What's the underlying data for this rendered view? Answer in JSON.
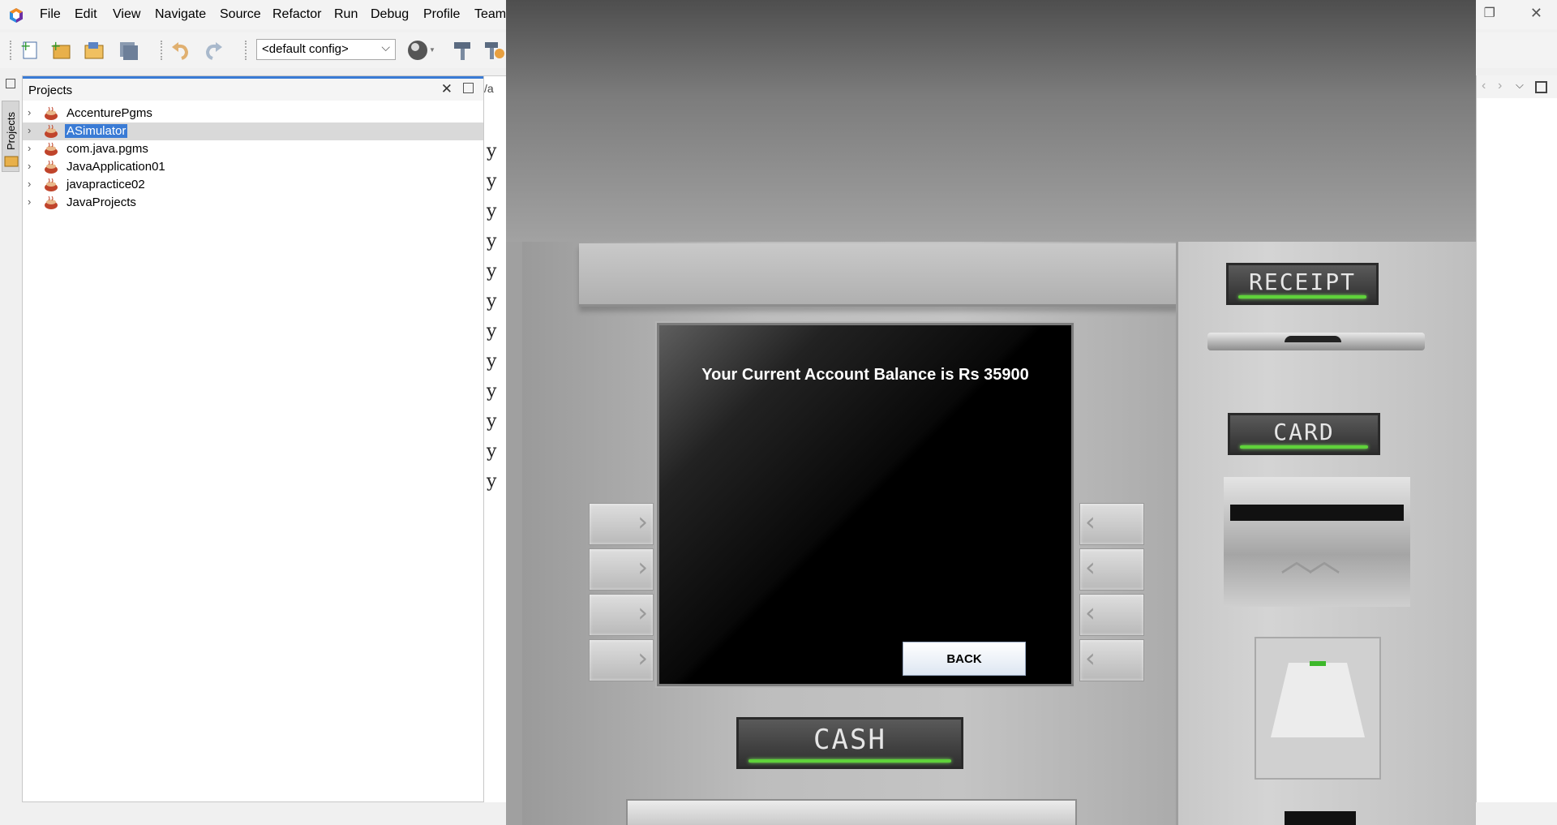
{
  "ide": {
    "menu": [
      "File",
      "Edit",
      "View",
      "Navigate",
      "Source",
      "Refactor",
      "Run",
      "Debug",
      "Profile",
      "Team"
    ],
    "toolbar": {
      "config_value": "<default config>",
      "buttons": [
        "new-file-icon",
        "new-project-icon",
        "open-project-icon",
        "save-all-icon",
        "undo-icon",
        "redo-icon",
        "run-globe-icon",
        "build-hammer-icon",
        "clean-build-icon"
      ]
    },
    "side_tab_label": "Projects",
    "projects_panel": {
      "title": "Projects",
      "items": [
        {
          "label": "AccenturePgms",
          "selected": false
        },
        {
          "label": "ASimulator",
          "selected": true
        },
        {
          "label": "com.java.pgms",
          "selected": false
        },
        {
          "label": "JavaApplication01",
          "selected": false
        },
        {
          "label": "javapractice02",
          "selected": false
        },
        {
          "label": "JavaProjects",
          "selected": false
        }
      ]
    },
    "editor_tab_fragment": "/a",
    "code_fragments": [
      "y",
      "y",
      "y",
      "y",
      "y",
      "y",
      "y",
      "y",
      "y",
      "y",
      "y",
      "y"
    ]
  },
  "atm": {
    "screen_message": "Your Current Account Balance is Rs 35900",
    "back_button": "BACK",
    "labels": {
      "receipt": "RECEIPT",
      "card": "CARD",
      "cash": "CASH"
    },
    "colors": {
      "indicator_green": "#5fd23a",
      "screen_black": "#000000",
      "label_dark": "#3a3a3a"
    },
    "left_keys": [
      "›",
      "›",
      "›",
      "›"
    ],
    "right_keys": [
      "‹",
      "‹",
      "‹",
      "‹"
    ]
  }
}
